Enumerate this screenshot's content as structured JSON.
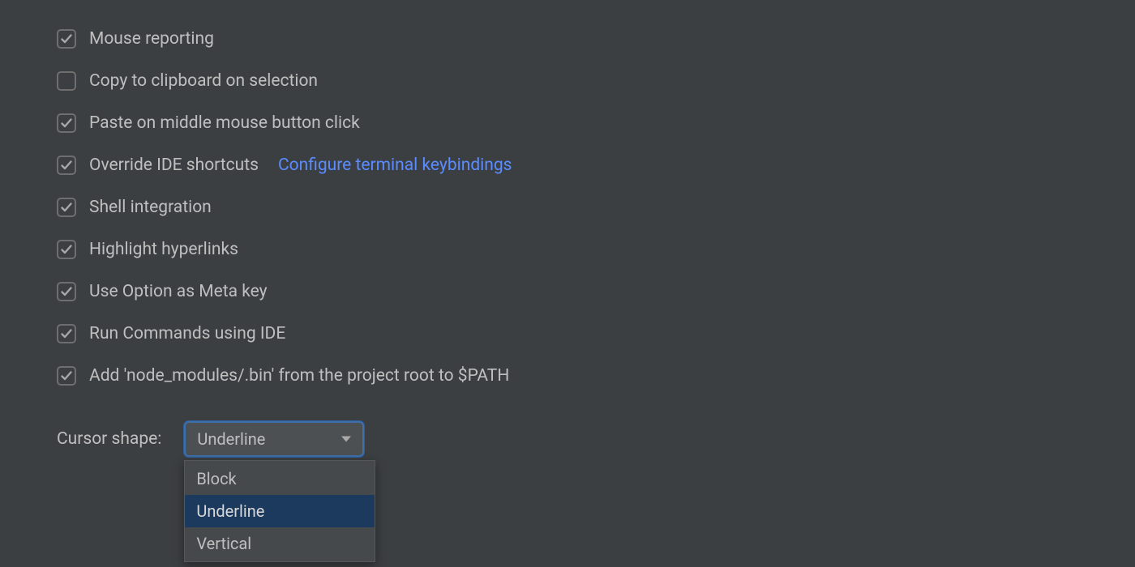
{
  "options": [
    {
      "key": "mouse_reporting",
      "label": "Mouse reporting",
      "checked": true
    },
    {
      "key": "copy_on_select",
      "label": "Copy to clipboard on selection",
      "checked": false
    },
    {
      "key": "paste_middle",
      "label": "Paste on middle mouse button click",
      "checked": true
    },
    {
      "key": "override_shortcuts",
      "label": "Override IDE shortcuts",
      "checked": true,
      "link": "Configure terminal keybindings"
    },
    {
      "key": "shell_integration",
      "label": "Shell integration",
      "checked": true
    },
    {
      "key": "highlight_links",
      "label": "Highlight hyperlinks",
      "checked": true
    },
    {
      "key": "option_as_meta",
      "label": "Use Option as Meta key",
      "checked": true
    },
    {
      "key": "run_cmds_ide",
      "label": "Run Commands using IDE",
      "checked": true
    },
    {
      "key": "node_bin_path",
      "label": "Add 'node_modules/.bin' from the project root to $PATH",
      "checked": true
    }
  ],
  "cursor_shape": {
    "label": "Cursor shape:",
    "selected": "Underline",
    "options": [
      "Block",
      "Underline",
      "Vertical"
    ]
  }
}
